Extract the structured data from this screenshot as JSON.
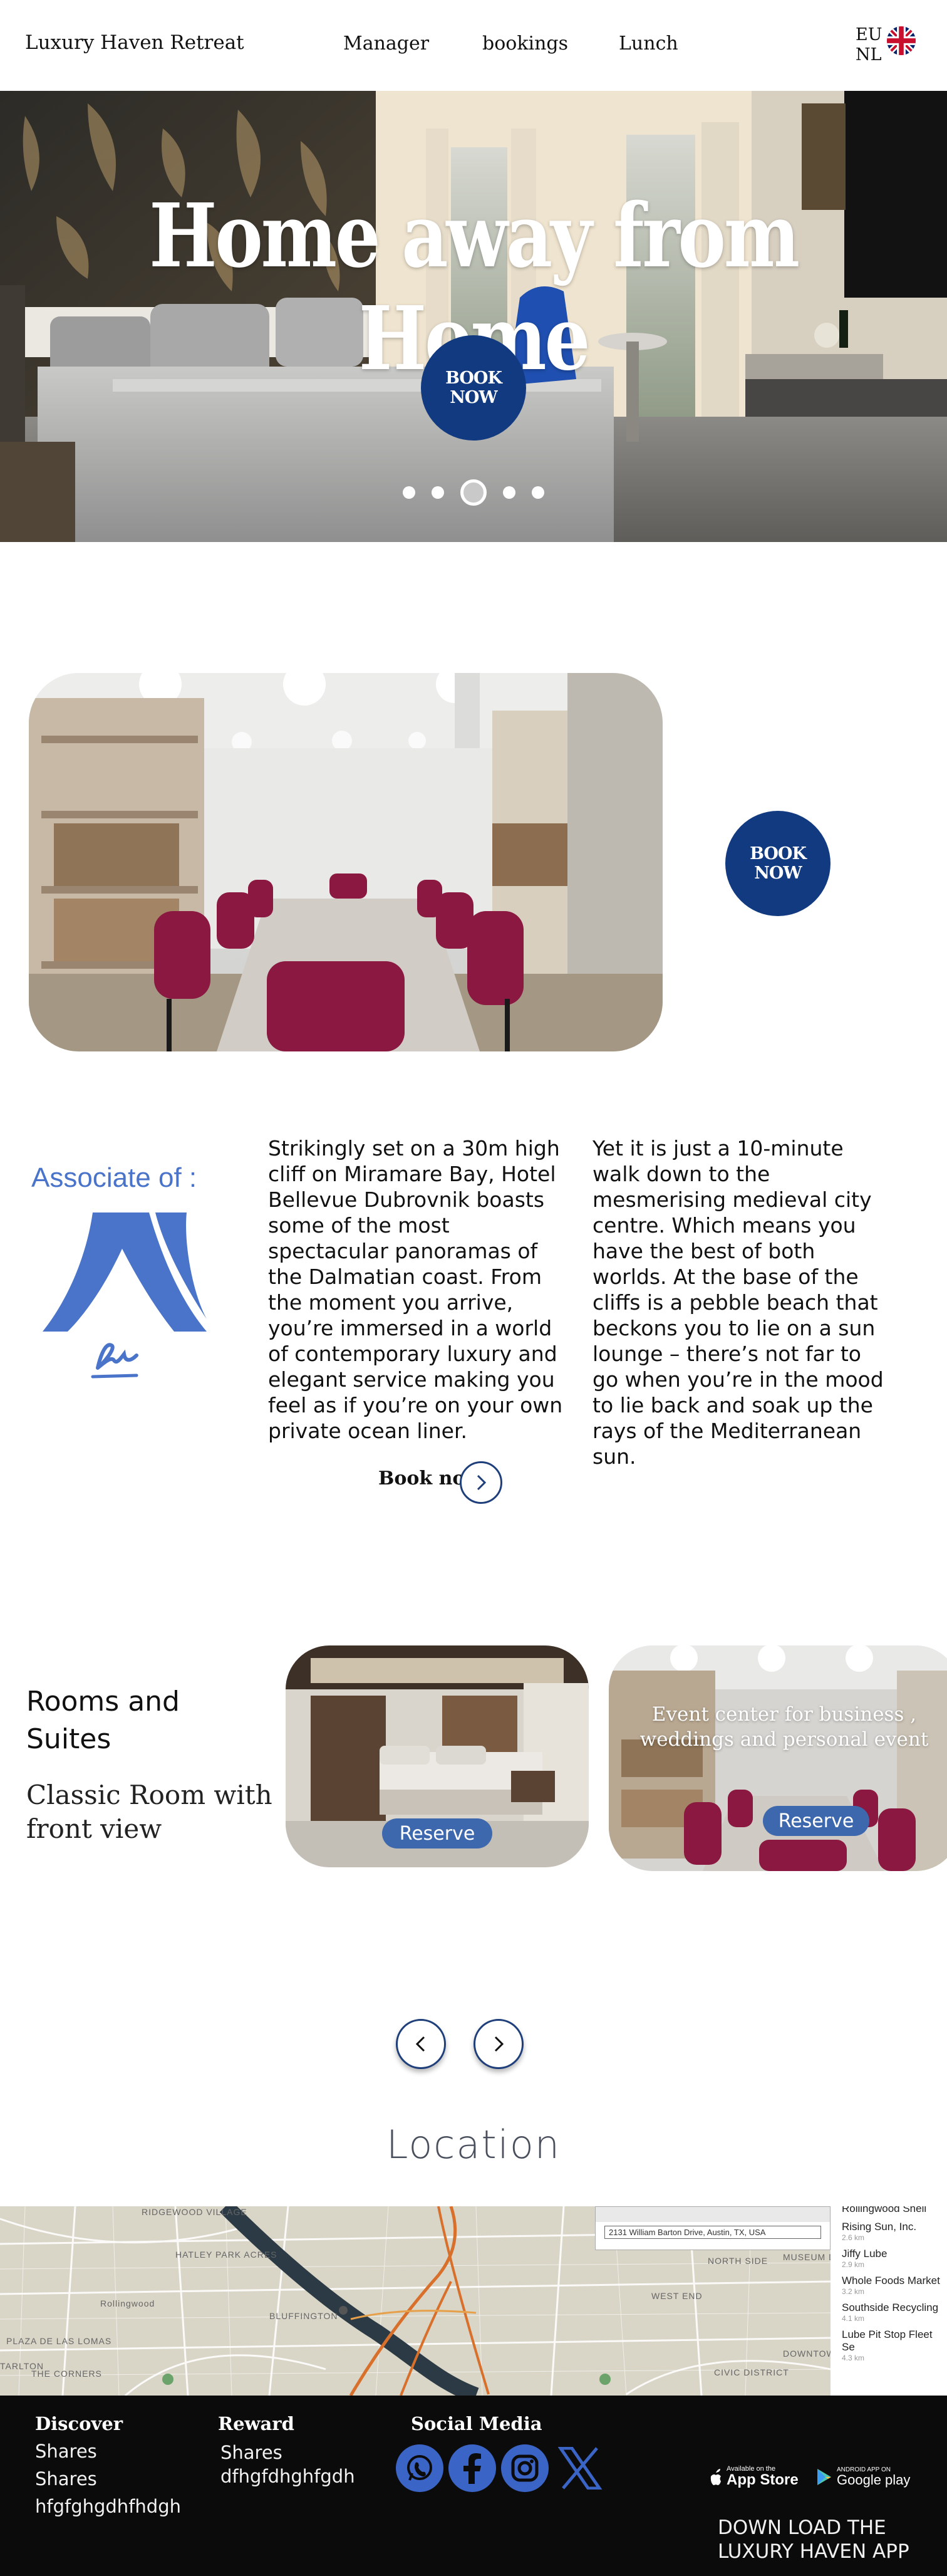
{
  "header": {
    "brand": "Luxury Haven Retreat",
    "nav": [
      "Manager",
      "bookings",
      "Lunch"
    ],
    "lang_primary": "EU",
    "lang_secondary": "NL"
  },
  "hero": {
    "title": "Home away from Home",
    "cta": "BOOK NOW",
    "slide_count": 5,
    "active_slide": 3
  },
  "meeting": {
    "cta": "BOOK NOW"
  },
  "about": {
    "associate_label": "Associate of :",
    "para1": "Strikingly set on a 30m high cliff on Miramare Bay, Hotel Bellevue Dubrovnik boasts some of the most spectacular panoramas of the Dalmatian coast. From the moment you arrive, you’re immersed in a world of contemporary luxury and elegant service making you feel as if you’re on your own private ocean liner.",
    "para2": "Yet it is just a 10-minute walk down to the mesmerising medieval city centre. Which means you have the best of both worlds. At the base of the cliffs is a pebble beach that beckons you to lie on a sun lounge – there’s not far to go when you’re in the mood to lie back and soak up the rays of the Mediterranean sun.",
    "book_link": "Book now"
  },
  "rooms": {
    "title": "Rooms and Suites",
    "subtitle": "Classic Room with front view",
    "cards": [
      {
        "reserve": "Reserve"
      },
      {
        "caption": "Event center for business , weddings and personal event",
        "reserve": "Reserve"
      }
    ]
  },
  "location": {
    "title": "Location",
    "address": "2131 William Barton Drive, Austin, TX, USA",
    "places": [
      {
        "name": "Rollingwood Shell",
        "dist": ""
      },
      {
        "name": "Rising Sun, Inc.",
        "dist": "2.6 km"
      },
      {
        "name": "Jiffy Lube",
        "dist": "2.9 km"
      },
      {
        "name": "Whole Foods Market",
        "dist": "3.2 km"
      },
      {
        "name": "Southside Recycling",
        "dist": "4.1 km"
      },
      {
        "name": "Lube Pit Stop Fleet Se",
        "dist": "4.3 km"
      }
    ],
    "map_labels": [
      "RIDGEWOOD VILLAGE",
      "HATLEY PARK ACRES",
      "BLUFFINGTON",
      "PLAZA DE LAS LOMAS",
      "TARLTON",
      "THE CORNERS",
      "NORTH SIDE",
      "WEST END",
      "MUSEUM DISTRICT",
      "DOWNTOWN AUSTIN",
      "CIVIC DISTRICT",
      "Rollingwood"
    ]
  },
  "footer": {
    "discover": {
      "heading": "Discover",
      "links": [
        "Shares",
        "Shares",
        "hfgfghgdhfhdgh"
      ]
    },
    "reward": {
      "heading": "Reward",
      "links": [
        "Shares",
        "dfhgfdhghfgdh"
      ]
    },
    "social": {
      "heading": "Social Media",
      "icons": [
        "whatsapp-icon",
        "facebook-icon",
        "instagram-icon",
        "x-icon"
      ]
    },
    "app_store_small": "Available on the",
    "app_store": "App Store",
    "google_small": "ANDROID APP ON",
    "google": "Google play",
    "download_text": "DOWN LOAD THE LUXURY HAVEN APP"
  },
  "colors": {
    "brand_blue": "#113a80",
    "accent_blue": "#3b64c7",
    "reserve_blue": "#3e68ad",
    "associate_blue": "#4a74c9"
  }
}
